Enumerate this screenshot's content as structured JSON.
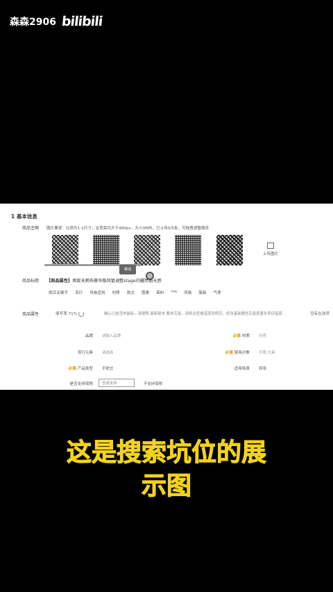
{
  "watermark": {
    "user": "森森2906",
    "logo": "bilibili"
  },
  "section": {
    "title": "1  基本信息"
  },
  "labels": {
    "main_images": "商品主图",
    "product_title": "商品标题",
    "attributes": "商品属性"
  },
  "images": {
    "hint": "图片要求：比例为1:1尺寸，且宽高均大于480px，大小3M内，已上传0/5张，可拖拽调整顺序",
    "drag_label": "移动",
    "upload_label": "上传图片"
  },
  "title": {
    "prefix": "【商品属性】",
    "text": "男款无雨布豪华版风管调整stage闪耀亮丽光感"
  },
  "tags": [
    "类目关键字",
    "流行",
    "风格适用",
    "材质",
    "款式",
    "图案",
    "面料",
    "rns",
    "风格",
    "服装",
    "气质"
  ],
  "attribute_row": {
    "fill_rate": "填写率 71%",
    "description": "确认已是否的最新，请遵照 最新版本 要求完善，请务必查看错误说明后，修改基础属性完善度量化项目指南",
    "link": "没有在选项"
  },
  "fields": [
    {
      "label": "品牌",
      "value": "请输入品牌"
    },
    {
      "label": "流行元素",
      "value": "请选择"
    },
    {
      "label": "产品类型",
      "value": "手提式",
      "required": true
    }
  ],
  "fields_right": [
    {
      "label": "材质",
      "value": "无明",
      "required": true
    },
    {
      "label": "使用对象",
      "value": "不限  文具",
      "required": true
    },
    {
      "label": "适用场景",
      "value": "商场"
    }
  ],
  "bottom_field": {
    "label": "是否支持保税",
    "placeholder": "否请支持",
    "extra": "不支持保税"
  },
  "caption": {
    "line1": "这是搜索坑位的展",
    "line2": "示图"
  }
}
